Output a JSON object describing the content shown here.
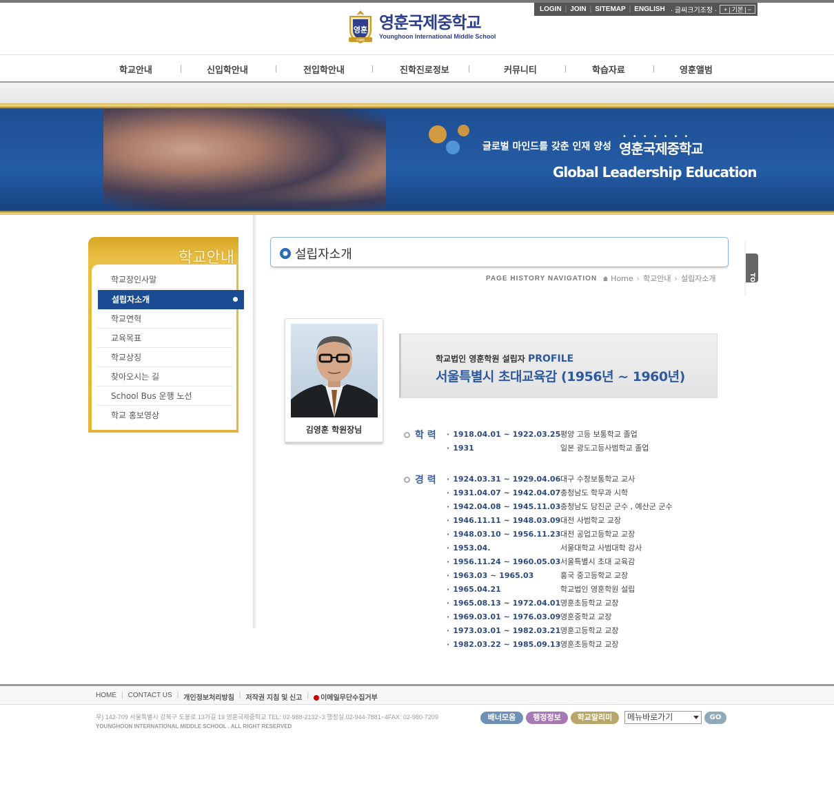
{
  "util": {
    "login": "LOGIN",
    "join": "JOIN",
    "sitemap": "SITEMAP",
    "english": "ENGLISH",
    "font_size_label": "· 글씨크기조정 ·",
    "font_plus": "+",
    "font_default": "기본",
    "font_minus": "−"
  },
  "logo": {
    "emblem_text": "영훈",
    "emblem_ribbon": "YIMS",
    "name_ko": "영훈국제중학교",
    "name_en": "Younghoon International Middle School"
  },
  "gnb": [
    {
      "label": "학교안내"
    },
    {
      "label": "신입학안내"
    },
    {
      "label": "전입학안내"
    },
    {
      "label": "진학진로정보"
    },
    {
      "label": "커뮤니티"
    },
    {
      "label": "학습자료"
    },
    {
      "label": "영훈앨범"
    }
  ],
  "banner": {
    "slogan": "글로벌 마인드를 갖춘 인재 양성",
    "school": "영훈국제중학교",
    "dots": "•••••••",
    "english": "Global Leadership Education"
  },
  "lnb": {
    "title": "학교안내",
    "items": [
      {
        "label": "학교장인사말",
        "active": false
      },
      {
        "label": "설립자소개",
        "active": true
      },
      {
        "label": "학교연혁",
        "active": false
      },
      {
        "label": "교육목표",
        "active": false
      },
      {
        "label": "학교상징",
        "active": false
      },
      {
        "label": "찾아오시는 길",
        "active": false
      },
      {
        "label": "School Bus 운행 노선",
        "active": false
      },
      {
        "label": "학교 홍보영상",
        "active": false
      }
    ]
  },
  "page": {
    "title": "설립자소개",
    "top_button": "TOP",
    "path_label": "PAGE HISTORY NAVIGATION",
    "path": [
      "Home",
      "학교안내",
      "설립자소개"
    ]
  },
  "founder": {
    "name": "김영훈 학원장님",
    "profile_sub": "학교법인 영훈학원 설립자",
    "profile_tag": "PROFILE",
    "profile_main": "서울특별시 초대교육감 (1956년 ~ 1960년)"
  },
  "education": {
    "heading": "학 력",
    "rows": [
      {
        "date": "1918.04.01 ~ 1922.03.25",
        "desc": "평양 고등 보통학교 졸업"
      },
      {
        "date": "1931",
        "desc": "일본 광도고등사범학교 졸업"
      }
    ]
  },
  "career": {
    "heading": "경 력",
    "rows": [
      {
        "date": "1924.03.31 ~ 1929.04.06",
        "desc": "대구 수창보통학교 교사"
      },
      {
        "date": "1931.04.07 ~ 1942.04.07",
        "desc": "충청남도 학무과 시학"
      },
      {
        "date": "1942.04.08 ~ 1945.11.03",
        "desc": "충청남도 당진군 군수 , 예산군 군수"
      },
      {
        "date": "1946.11.11 ~ 1948.03.09",
        "desc": "대전 사범학교 교장"
      },
      {
        "date": "1948.03.10 ~ 1956.11.23",
        "desc": "대전 공업고등학교 교장"
      },
      {
        "date": "1953.04.",
        "desc": "서울대학교 사범대학 강사"
      },
      {
        "date": "1956.11.24 ~ 1960.05.03",
        "desc": "서울특별시 초대 교육감"
      },
      {
        "date": "1963.03 ~ 1965.03",
        "desc": "홍국 중고등학교 교장"
      },
      {
        "date": "1965.04.21",
        "desc": "학교법인 영훈학원 설립"
      },
      {
        "date": "1965.08.13 ~ 1972.04.01",
        "desc": "영훈초등학교 교장"
      },
      {
        "date": "1969.03.01 ~ 1976.03.09",
        "desc": "영훈중학교 교장"
      },
      {
        "date": "1973.03.01 ~ 1982.03.21",
        "desc": "영훈고등학교 교장"
      },
      {
        "date": "1982.03.22 ~ 1985.09.13",
        "desc": "영훈초등학교 교장"
      }
    ]
  },
  "footer": {
    "links": [
      "HOME",
      "CONTACT US",
      "개인정보처리방침",
      "저작권 지침 및 신고",
      "이메일무단수집거부"
    ],
    "address": "우) 142-709 서울특별시 강북구 도봉로 13가길 19 영훈국제중학교  TEL: 02-988-2132~3 행정실.02-944-7881~4FAX: 02-980-7209",
    "copyright": "YOUNGHOON INTERNATIONAL MIDDLE SCHOOL . ALL RIGHT RESERVED",
    "buttons": [
      "배너모음",
      "행정정보",
      "학교알리미"
    ],
    "quick_select": "메뉴바로가기",
    "go": "GO"
  },
  "colors": {
    "brand_blue": "#1b4b92",
    "gold": "#d9a625",
    "banner_blue": "#245ca6"
  }
}
